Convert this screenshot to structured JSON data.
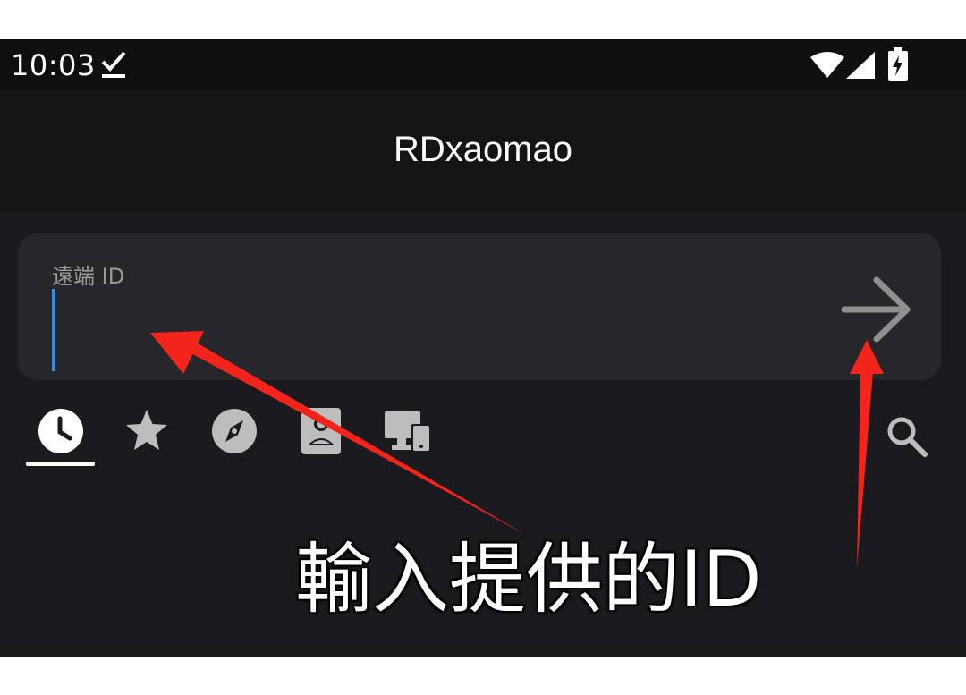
{
  "status_bar": {
    "time": "10:03",
    "icons": [
      "download-done-icon",
      "wifi-icon",
      "cell-signal-icon",
      "battery-charging-icon"
    ]
  },
  "app_bar": {
    "title": "RDxaomao"
  },
  "remote_id": {
    "label": "遠端 ID",
    "value": "",
    "submit_icon": "arrow-right-icon"
  },
  "tabs": [
    {
      "icon": "clock-icon",
      "name": "recent",
      "selected": true
    },
    {
      "icon": "star-icon",
      "name": "favorites"
    },
    {
      "icon": "compass-icon",
      "name": "discovered"
    },
    {
      "icon": "contact-icon",
      "name": "address-book"
    },
    {
      "icon": "devices-icon",
      "name": "group"
    }
  ],
  "search_icon": "search-icon",
  "annotation": {
    "caption": "輸入提供的ID",
    "arrow_color": "#f2241c"
  },
  "colors": {
    "background": "#1b1b1f",
    "card": "#26262b",
    "cursor": "#2f8fe8",
    "text": "#ffffff",
    "muted": "#9b9b9b"
  }
}
